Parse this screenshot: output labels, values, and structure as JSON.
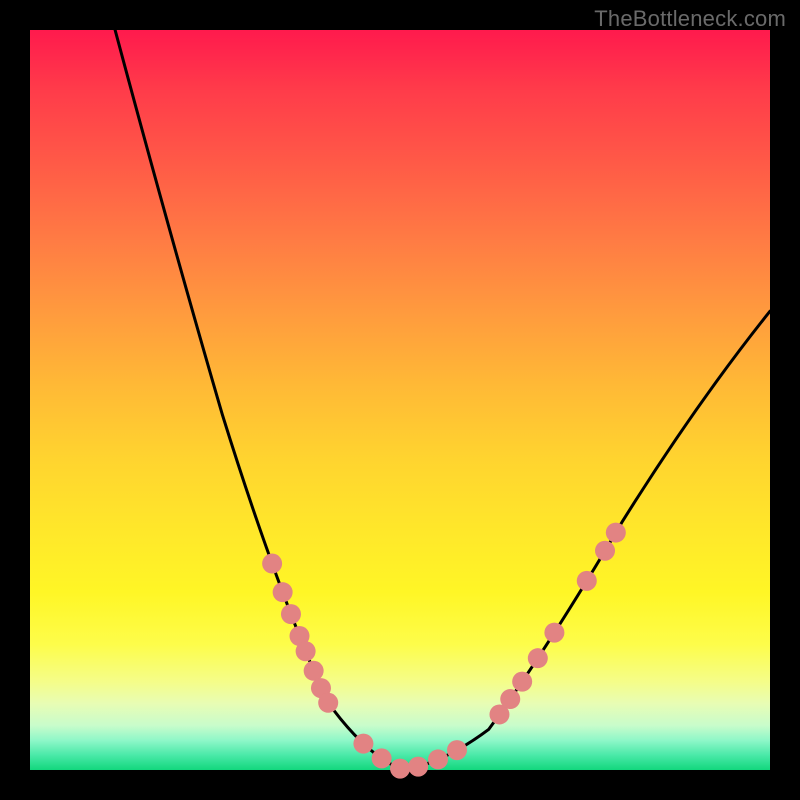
{
  "watermark": "TheBottleneck.com",
  "chart_data": {
    "type": "line",
    "title": "",
    "xlabel": "",
    "ylabel": "",
    "ylim": [
      0,
      100
    ],
    "series": [
      {
        "name": "curve",
        "x": [
          0.0,
          0.05,
          0.1,
          0.15,
          0.2,
          0.25,
          0.3,
          0.35,
          0.4,
          0.45,
          0.5,
          0.55,
          0.6,
          0.65,
          0.7,
          0.75,
          0.8,
          0.85,
          0.9,
          0.95,
          1.0
        ],
        "y": [
          1.0,
          0.84,
          0.68,
          0.53,
          0.4,
          0.28,
          0.19,
          0.11,
          0.05,
          0.015,
          0.0,
          0.005,
          0.02,
          0.06,
          0.12,
          0.2,
          0.29,
          0.38,
          0.47,
          0.55,
          0.62
        ],
        "color": "#000000"
      }
    ],
    "markers": {
      "left_branch": [
        0.28,
        0.24,
        0.21,
        0.18,
        0.16,
        0.135,
        0.11,
        0.09
      ],
      "right_branch": [
        0.075,
        0.095,
        0.12,
        0.15,
        0.185,
        0.255,
        0.295,
        0.32
      ],
      "bottom": [
        0.45,
        0.475,
        0.5,
        0.525,
        0.55,
        0.578
      ],
      "color": "#e28383",
      "radius": 10
    }
  }
}
